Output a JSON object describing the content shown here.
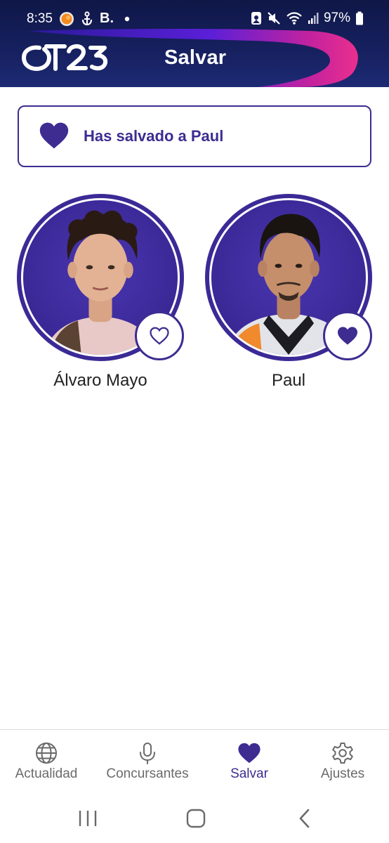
{
  "status_bar": {
    "time": "8:35",
    "left_icons": [
      "app-notification-icon",
      "anchor-icon",
      "bold-b-icon",
      "dot-icon"
    ],
    "left_b_text": "B.",
    "right_icons": [
      "photo-icon",
      "mute-icon",
      "wifi-icon",
      "signal-icon",
      "battery-icon"
    ],
    "battery_percent": "97%"
  },
  "app_bar": {
    "logo_text": "OT23",
    "title": "Salvar"
  },
  "banner": {
    "icon": "heart-icon",
    "message": "Has salvado a Paul"
  },
  "contestants": [
    {
      "name": "Álvaro Mayo",
      "saved": false,
      "fav_icon": "heart-outline-icon"
    },
    {
      "name": "Paul",
      "saved": true,
      "fav_icon": "heart-filled-icon"
    }
  ],
  "bottom_nav": {
    "items": [
      {
        "label": "Actualidad",
        "icon": "globe-icon",
        "active": false
      },
      {
        "label": "Concursantes",
        "icon": "microphone-icon",
        "active": false
      },
      {
        "label": "Salvar",
        "icon": "heart-icon",
        "active": true
      },
      {
        "label": "Ajustes",
        "icon": "gear-icon",
        "active": false
      }
    ]
  },
  "system_nav": {
    "buttons": [
      "recents-icon",
      "home-icon",
      "back-icon"
    ]
  },
  "colors": {
    "accent": "#3e2c91",
    "header_dark": "#0f1747",
    "swoosh_purple": "#4b1fd6",
    "swoosh_pink": "#e02a9a",
    "inactive_text": "#6a6a6a"
  }
}
